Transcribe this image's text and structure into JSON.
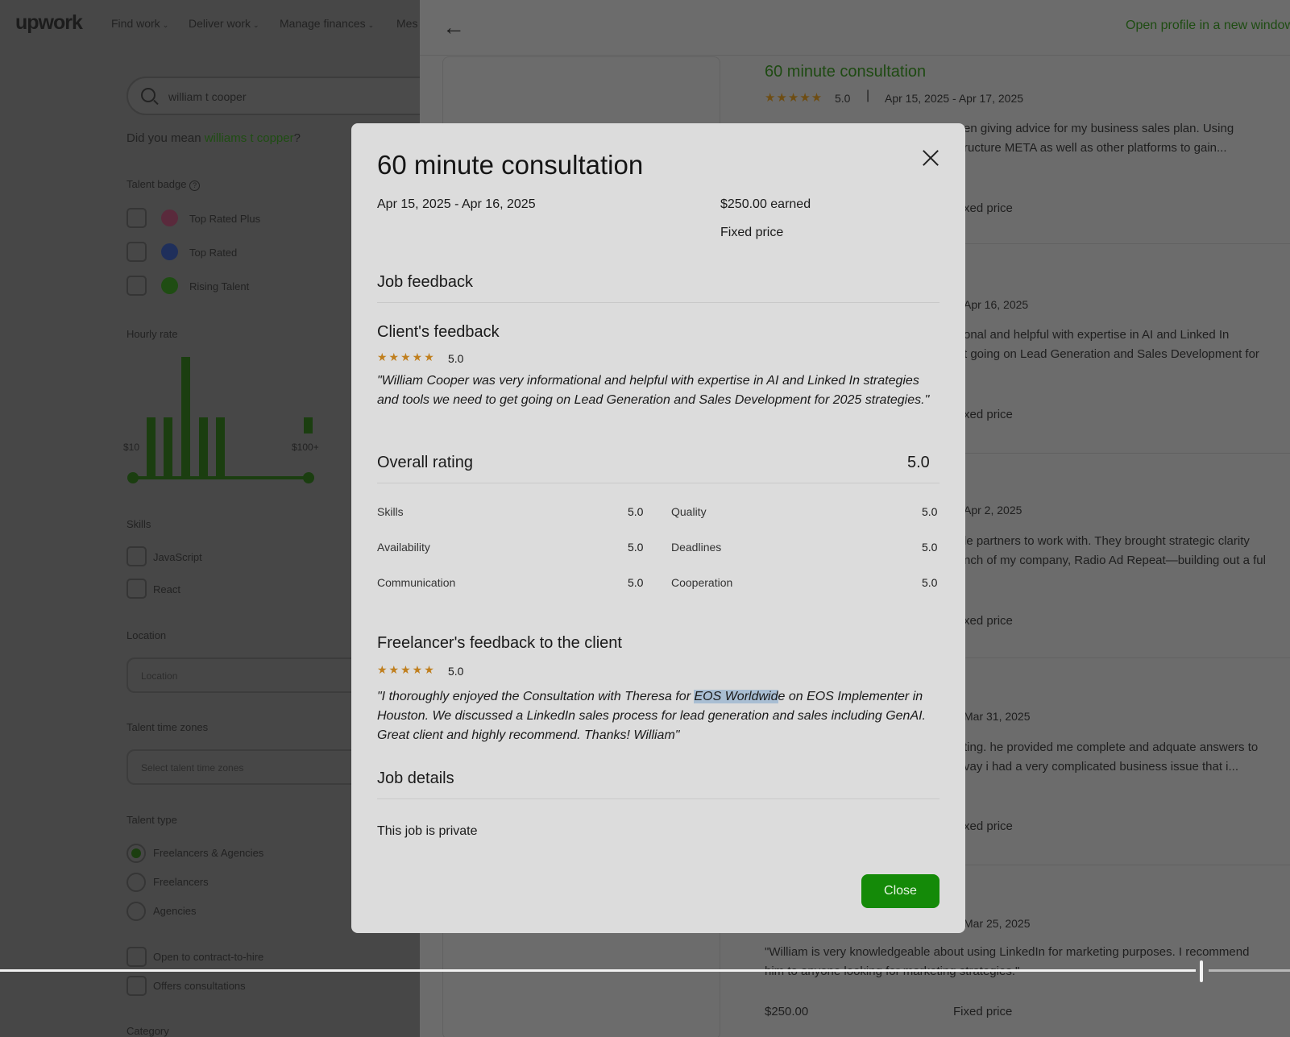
{
  "nav": {
    "logo": "upwork",
    "items": [
      "Find work",
      "Deliver work",
      "Manage finances",
      "Mes"
    ]
  },
  "search": {
    "query": "william  t cooper"
  },
  "did_you_mean": {
    "prefix": "Did you mean ",
    "suggestion": "williams t copper",
    "suffix": "?"
  },
  "filters": {
    "talent_badge_label": "Talent badge",
    "badges": [
      "Top Rated Plus",
      "Top Rated",
      "Rising Talent"
    ],
    "hourly_rate_label": "Hourly rate",
    "rate_min": "$10",
    "rate_max": "$100+",
    "skills_label": "Skills",
    "skills": [
      "JavaScript",
      "React"
    ],
    "location_label": "Location",
    "location_placeholder": "Location",
    "time_zones_label": "Talent time zones",
    "time_zones_placeholder": "Select talent time zones",
    "talent_type_label": "Talent type",
    "talent_types": [
      "Freelancers & Agencies",
      "Freelancers",
      "Agencies"
    ],
    "selected_talent_type": "Freelancers & Agencies",
    "extra_options": [
      "Open to contract-to-hire",
      "Offers consultations"
    ],
    "category_label": "Category"
  },
  "profile_panel": {
    "open_link": "Open profile in a new window",
    "job_title": "60 minute consultation",
    "rating": "5.0",
    "date_range": "Apr 15, 2025 - Apr 17, 2025",
    "snippets": [
      "en giving advice for my business sales plan. Using",
      "ructure META as well as other platforms to gain...",
      "onal and helpful with expertise in AI and Linked In",
      "t going on Lead Generation and Sales Development for",
      "le partners to work with. They brought strategic clarity",
      "nch of my company, Radio Ad Repeat—building out a ful",
      "ting. he provided me complete and adquate answers to",
      "vay i had a very complicated business issue that i..."
    ],
    "price_type": "xed price",
    "dates": [
      "Apr 16, 2025",
      "Apr 2, 2025",
      "Mar 31, 2025",
      "Mar 25, 2025"
    ],
    "bottom_review_lines": [
      "\"William is very knowledgeable about using LinkedIn for marketing purposes. I recommend",
      "him to anyone looking for marketing strategies.\""
    ],
    "bottom_amount": "$250.00",
    "bottom_price_type": "Fixed price"
  },
  "modal": {
    "title": "60 minute consultation",
    "dates": "Apr 15, 2025 - Apr 16, 2025",
    "earned": "$250.00 earned",
    "price_type": "Fixed price",
    "job_feedback_heading": "Job feedback",
    "client_feedback_heading": "Client's feedback",
    "client_rating": "5.0",
    "client_stars": 5,
    "client_quote": "\"William Cooper was very informational and helpful with expertise in AI and Linked In strategies and tools we need to get going on Lead Generation and Sales Development for 2025 strategies.\"",
    "overall_heading": "Overall rating",
    "overall_value": "5.0",
    "sub_ratings": [
      {
        "label": "Skills",
        "value": "5.0"
      },
      {
        "label": "Quality",
        "value": "5.0"
      },
      {
        "label": "Availability",
        "value": "5.0"
      },
      {
        "label": "Deadlines",
        "value": "5.0"
      },
      {
        "label": "Communication",
        "value": "5.0"
      },
      {
        "label": "Cooperation",
        "value": "5.0"
      }
    ],
    "freelancer_feedback_heading": "Freelancer's feedback to the client",
    "freelancer_rating": "5.0",
    "freelancer_stars": 5,
    "freelancer_quote_start": "\"I thoroughly enjoyed the Consultation with Theresa for ",
    "freelancer_quote_highlight": "EOS Worldwid",
    "freelancer_quote_end": "e on EOS Implementer in Houston. We discussed a LinkedIn sales process for lead generation and sales including GenAI. Great client and highly recommend. Thanks! William\"",
    "job_details_heading": "Job details",
    "job_private": "This job is private",
    "close_button": "Close"
  },
  "player": {
    "progress": 0.93
  },
  "colors": {
    "brand_green": "#14a800",
    "close_button_bg": "#148a08",
    "star": "#c07f1e",
    "highlight": "#a9bed3"
  }
}
